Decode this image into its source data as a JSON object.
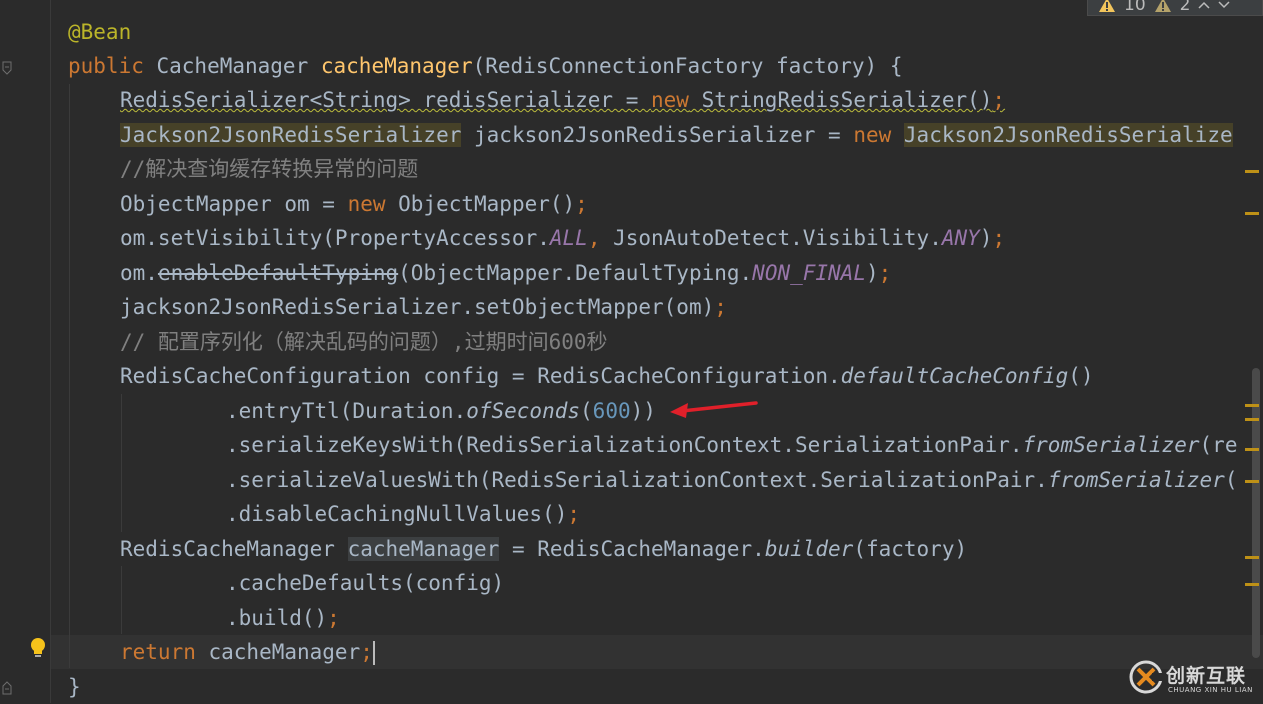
{
  "editor": {
    "language": "java",
    "theme": "darcula"
  },
  "inspection": {
    "warning_count": "10",
    "weak_warning_count": "2"
  },
  "code": {
    "l1_annotation": "@Bean",
    "l2_public": "public",
    "l2_type": " CacheManager ",
    "l2_method": "cacheManager",
    "l2_params": "(RedisConnectionFactory factory) {",
    "l3_a": "RedisSerializer<String> redisSerializer = ",
    "l3_new": "new",
    "l3_b": " StringRedisSerializer()",
    "l3_semi": ";",
    "l4_type": "Jackson2JsonRedisSerializer",
    "l4_a": " jackson2JsonRedisSerializer = ",
    "l4_new": "new",
    "l4_sp": " ",
    "l4_type2": "Jackson2JsonRedisSerialize",
    "l5_comment": "//解决查询缓存转换异常的问题",
    "l6_a": "ObjectMapper om = ",
    "l6_new": "new",
    "l6_b": " ObjectMapper()",
    "l6_semi": ";",
    "l7_a": "om.setVisibility(PropertyAccessor.",
    "l7_all": "ALL",
    "l7_comma": ",",
    "l7_b": " JsonAutoDetect.Visibility.",
    "l7_any": "ANY",
    "l7_c": ")",
    "l7_semi": ";",
    "l8_a": "om.",
    "l8_strike": "enableDefaultTyping",
    "l8_b": "(ObjectMapper.DefaultTyping.",
    "l8_const": "NON_FINAL",
    "l8_c": ")",
    "l8_semi": ";",
    "l9_a": "jackson2JsonRedisSerializer.setObjectMapper(om)",
    "l9_semi": ";",
    "l10_comment": "// 配置序列化（解决乱码的问题）,过期时间600秒",
    "l11_a": "RedisCacheConfiguration config = RedisCacheConfiguration.",
    "l11_it": "defaultCacheConfig",
    "l11_b": "()",
    "l12_a": ".entryTtl(Duration.",
    "l12_it": "ofSeconds",
    "l12_b": "(",
    "l12_num": "600",
    "l12_c": "))",
    "l13_a": ".serializeKeysWith(RedisSerializationContext.SerializationPair.",
    "l13_it": "fromSerializer",
    "l13_b": "(re",
    "l14_a": ".serializeValuesWith(RedisSerializationContext.SerializationPair.",
    "l14_it": "fromSerializer",
    "l14_b": "(",
    "l15_a": ".disableCachingNullValues()",
    "l15_semi": ";",
    "l16_a": "RedisCacheManager ",
    "l16_hl": "cacheManager",
    "l16_b": " = RedisCacheManager.",
    "l16_it": "builder",
    "l16_c": "(factory)",
    "l17_a": ".cacheDefaults(config)",
    "l18_a": ".build()",
    "l18_semi": ";",
    "l19_return": "return",
    "l19_a": " cacheManager",
    "l19_semi": ";",
    "l20_a": "}"
  },
  "watermark": {
    "title": "创新互联",
    "subtitle": "CHUANG XIN HU LIAN"
  },
  "icons": {
    "fold": "fold-marker-icon",
    "bulb": "lightbulb-icon",
    "warning": "warning-icon",
    "weak_warning": "weak-warning-icon",
    "chevron_up": "chevron-up-icon",
    "chevron_down": "chevron-down-icon",
    "arrow": "red-arrow-annotation",
    "logo": "watermark-logo-icon"
  },
  "colors": {
    "background": "#2b2b2b",
    "keyword": "#cc7832",
    "annotation": "#bbb529",
    "method": "#ffc66d",
    "comment": "#808080",
    "number": "#6897bb",
    "constant": "#9876aa",
    "default_text": "#a9b7c6",
    "arrow": "#e0202a"
  }
}
